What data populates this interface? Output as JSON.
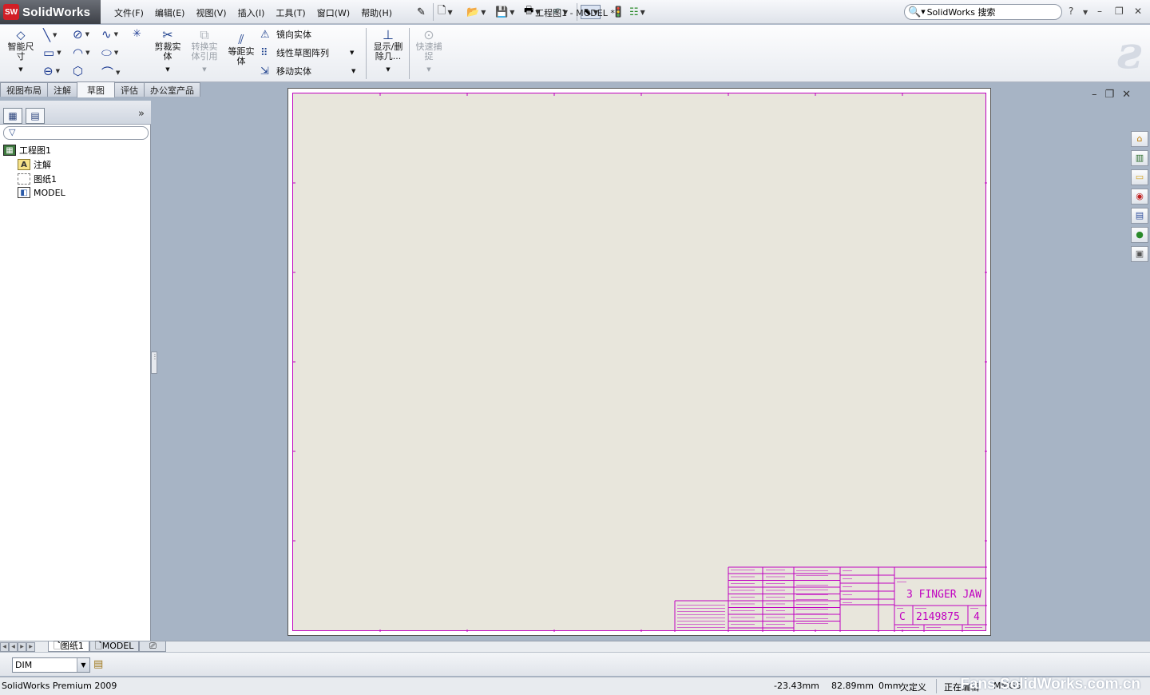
{
  "app": {
    "brand_badge": "SW",
    "brand_name": "SolidWorks",
    "window_title": "工程图1 - MODEL *"
  },
  "menu": [
    "文件(F)",
    "编辑(E)",
    "视图(V)",
    "插入(I)",
    "工具(T)",
    "窗口(W)",
    "帮助(H)"
  ],
  "search": {
    "value": "SolidWorks 搜索"
  },
  "commands": {
    "smart_dimension": "智能尺寸",
    "trim": "剪裁实体",
    "convert": "转换实体引用",
    "offset": "等距实体",
    "mirror": "镜向实体",
    "linear_pattern": "线性草图阵列",
    "move": "移动实体",
    "display_delete": "显示/删除几...",
    "quick_snap": "快速捕捉"
  },
  "command_tabs": [
    "视图布局",
    "注解",
    "草图",
    "评估",
    "办公室产品"
  ],
  "active_tab_index": 2,
  "tree": {
    "root": "工程图1",
    "items": [
      "注解",
      "图纸1",
      "MODEL"
    ]
  },
  "title_block": {
    "title": "3 FINGER JAW",
    "size": "C",
    "dwg_no": "2149875",
    "rev": "4"
  },
  "sheet_tabs": [
    "图纸1",
    "MODEL"
  ],
  "layer": {
    "value": "DIM"
  },
  "status": {
    "product": "SolidWorks Premium 2009",
    "x": "-23.43mm",
    "y": "82.89mm",
    "z": "0mm",
    "state": "欠定义",
    "mode": "正在编辑",
    "extra": "MMGS"
  },
  "watermark": "Fans SolidWorks.com.cn",
  "colors": {
    "frame": "#c000c0",
    "sheet_bg": "#e8e6dc",
    "viewport_bg": "#a7b4c5"
  }
}
